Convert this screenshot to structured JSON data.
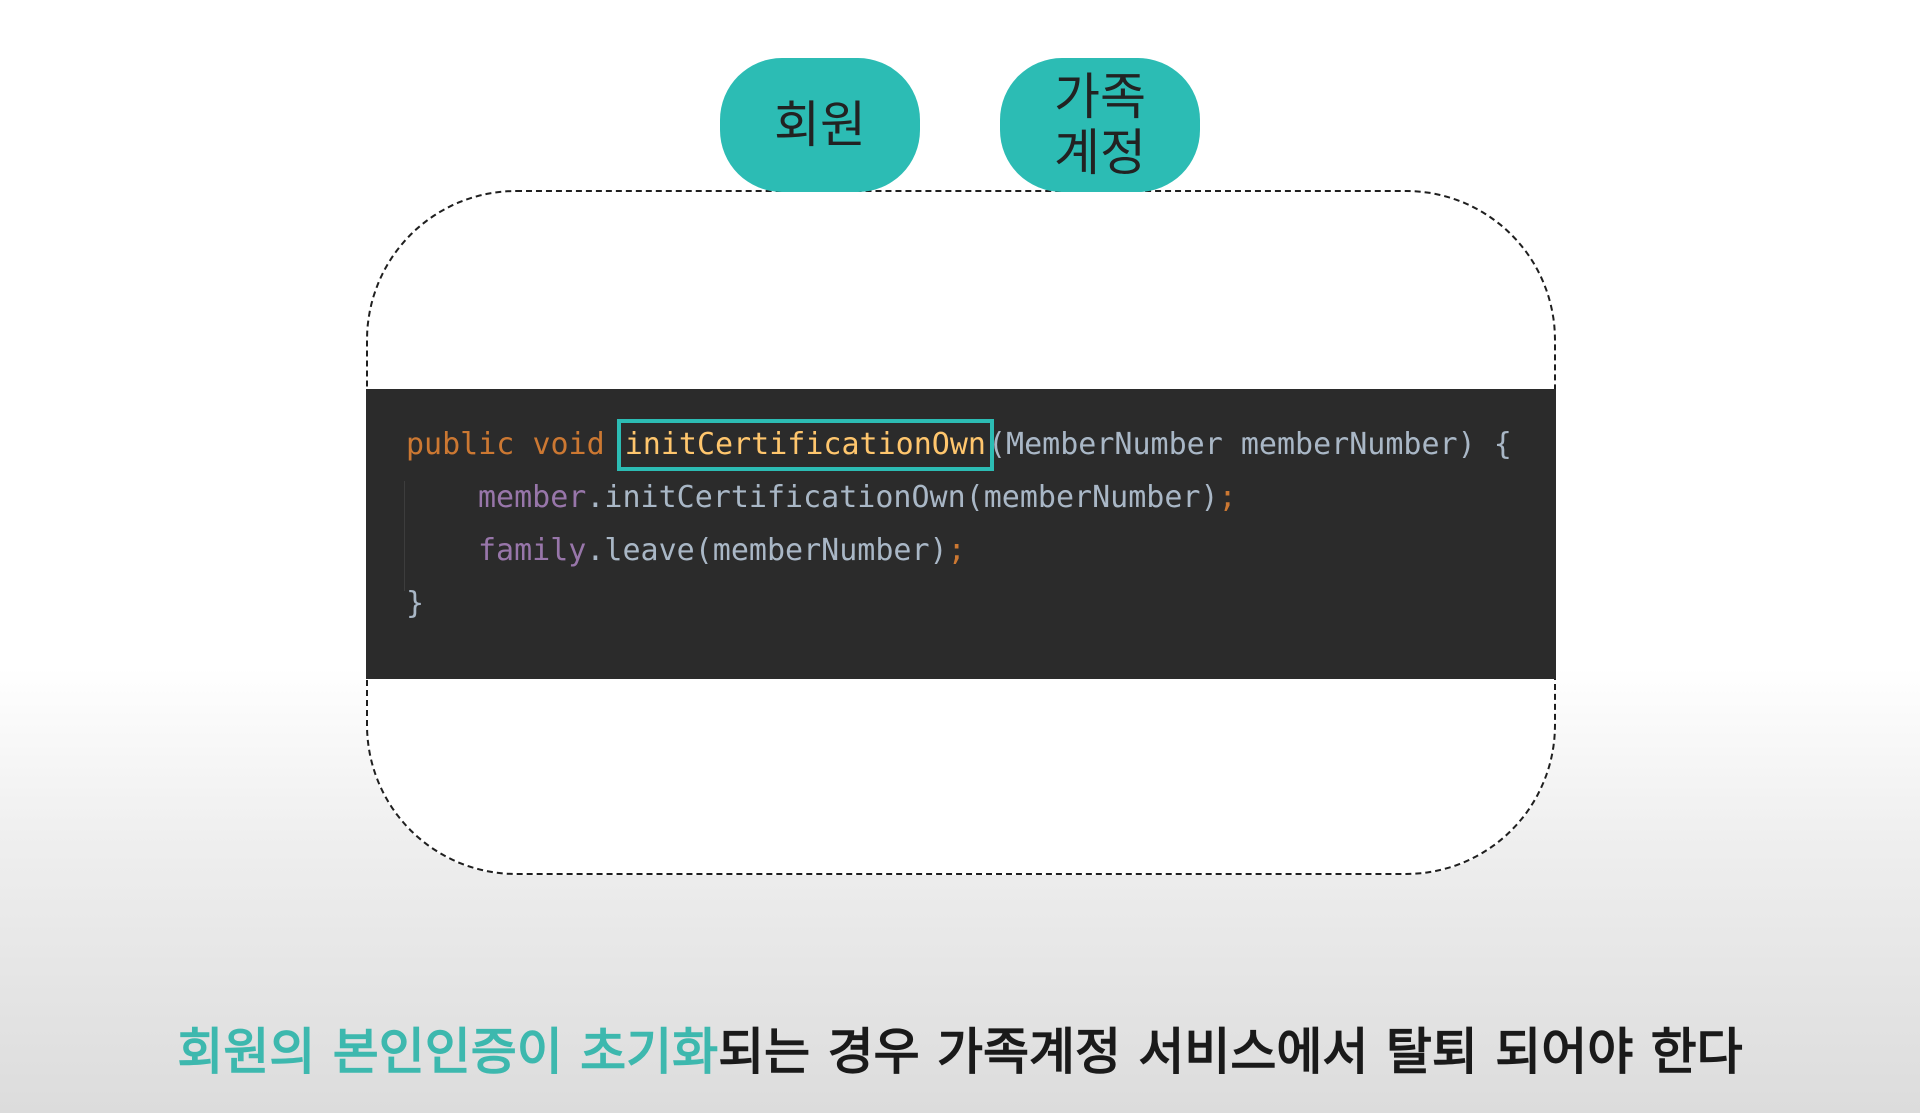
{
  "pills": {
    "member": "회원",
    "family": "가족\n계정"
  },
  "code": {
    "line1": {
      "kw_public": "public",
      "kw_void": "void",
      "method": "initCertificationOwn",
      "params": "(MemberNumber memberNumber) {"
    },
    "line2": {
      "field": "member",
      "call": ".initCertificationOwn(memberNumber)",
      "semi": ";"
    },
    "line3": {
      "field": "family",
      "call": ".leave(memberNumber)",
      "semi": ";"
    },
    "line4": "}"
  },
  "caption": {
    "highlight": "회원의 본인인증이 초기화",
    "rest": "되는 경우 가족계정 서비스에서 탈퇴 되어야 한다"
  },
  "colors": {
    "accent": "#2cbcb4",
    "code_bg": "#2b2b2b",
    "keyword": "#cc7832",
    "method": "#ffc66d",
    "field": "#9876aa"
  }
}
